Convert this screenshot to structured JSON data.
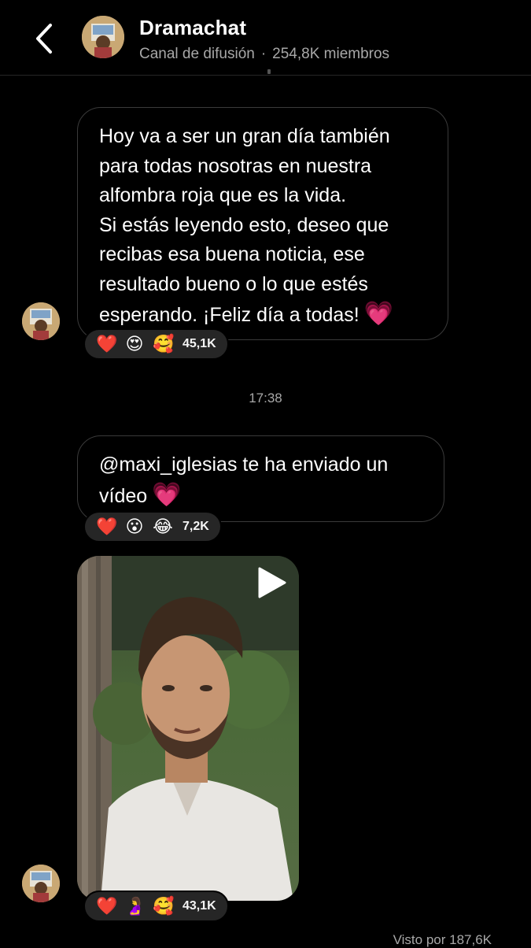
{
  "header": {
    "title": "Dramachat",
    "channel_type": "Canal de difusión",
    "separator": "·",
    "members": "254,8K miembros",
    "back_icon": "chevron-left-icon"
  },
  "messages": [
    {
      "type": "text",
      "lines": [
        "Hoy va a ser un gran día también para todas nosotras en nuestra alfombra roja que es la vida.",
        "Si estás leyendo esto, deseo que recibas esa buena noticia, ese resultado bueno o lo que estés esperando. ¡Feliz día a todas!"
      ],
      "trailing_emoji": "💗",
      "reactions": {
        "emojis": [
          "❤️",
          "😍",
          "🥰"
        ],
        "count": "45,1K"
      }
    },
    {
      "type": "text",
      "lines": [
        "@maxi_iglesias te ha enviado un vídeo"
      ],
      "trailing_emoji": "💗",
      "reactions": {
        "emojis": [
          "❤️",
          "😮",
          "😂"
        ],
        "count": "7,2K"
      }
    },
    {
      "type": "video",
      "reactions": {
        "emojis": [
          "❤️",
          "🤰",
          "🥰"
        ],
        "count": "43,1K"
      }
    }
  ],
  "timestamp": "17:38",
  "footer": {
    "seen": "Visto por 187,6K"
  },
  "colors": {
    "background": "#000000",
    "bubble_border": "#3a3a3a",
    "reaction_pill": "#262626",
    "muted_text": "#a8a8a8"
  }
}
